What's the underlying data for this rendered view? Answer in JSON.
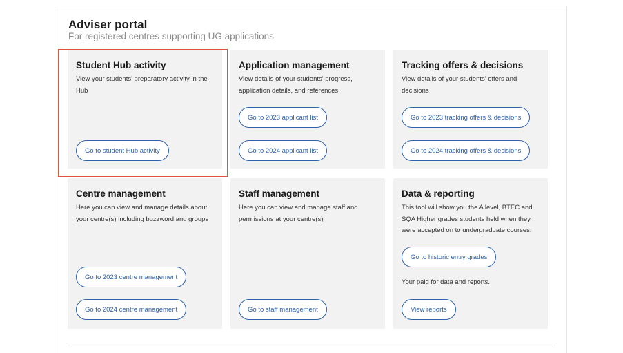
{
  "portal": {
    "title": "Adviser portal",
    "subtitle": "For registered centres supporting UG applications"
  },
  "cards": {
    "student_hub": {
      "title": "Student Hub activity",
      "description": "View your students' preparatory activity in the Hub",
      "buttons": [
        "Go to student Hub activity"
      ]
    },
    "application_management": {
      "title": "Application management",
      "description": "View details of your students' progress, application details, and references",
      "buttons": [
        "Go to 2023 applicant list",
        "Go to 2024 applicant list"
      ]
    },
    "tracking": {
      "title": "Tracking offers & decisions",
      "description": "View details of your students' offers and decisions",
      "buttons": [
        "Go to 2023 tracking offers & decisions",
        "Go to 2024 tracking offers & decisions"
      ]
    },
    "centre_management": {
      "title": "Centre management",
      "description": "Here you can view and manage details about your centre(s) including buzzword and groups",
      "buttons": [
        "Go to 2023 centre management",
        "Go to 2024 centre management"
      ]
    },
    "staff_management": {
      "title": "Staff management",
      "description": "Here you can view and manage staff and permissions at your centre(s)",
      "buttons": [
        "Go to staff management"
      ]
    },
    "data_reporting": {
      "title": "Data & reporting",
      "description": "This tool will show you the A level, BTEC and SQA Higher grades students held when they were accepted on to undergraduate courses.",
      "note": "Your paid for data and reports.",
      "buttons": [
        "Go to historic entry grades",
        "View reports"
      ]
    }
  },
  "colors": {
    "accent": "#2f62a8",
    "card_background": "#f2f2f2",
    "highlight_border": "#e2533f"
  }
}
